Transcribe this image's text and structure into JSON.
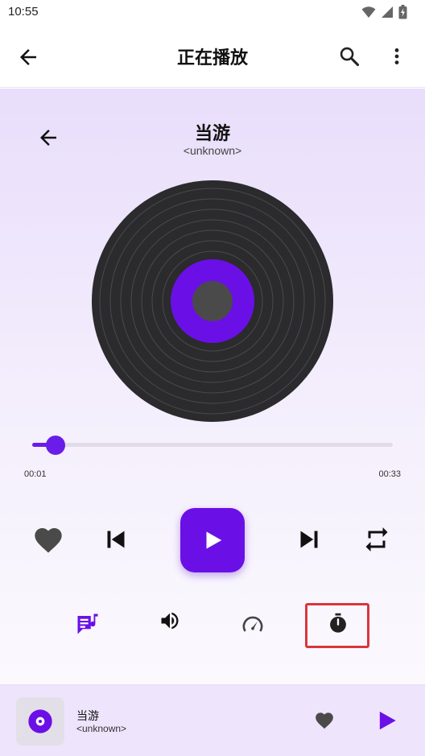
{
  "status_bar": {
    "time": "10:55"
  },
  "app_bar": {
    "title": "正在播放"
  },
  "player": {
    "track_title": "当游",
    "track_artist": "<unknown>",
    "progress": {
      "current": "00:01",
      "total": "00:33",
      "fraction": 0.03
    },
    "accent_color": "#6a10e6"
  },
  "mini_player": {
    "title": "当游",
    "artist": "<unknown>"
  },
  "icons": {
    "back": "arrow-left-icon",
    "search": "search-icon",
    "more": "more-vert-icon",
    "favorite": "heart-icon",
    "previous": "skip-previous-icon",
    "play": "play-icon",
    "next": "skip-next-icon",
    "repeat": "repeat-icon",
    "lyrics": "lyrics-icon",
    "volume": "volume-icon",
    "speed": "speedometer-icon",
    "timer": "timer-icon"
  }
}
